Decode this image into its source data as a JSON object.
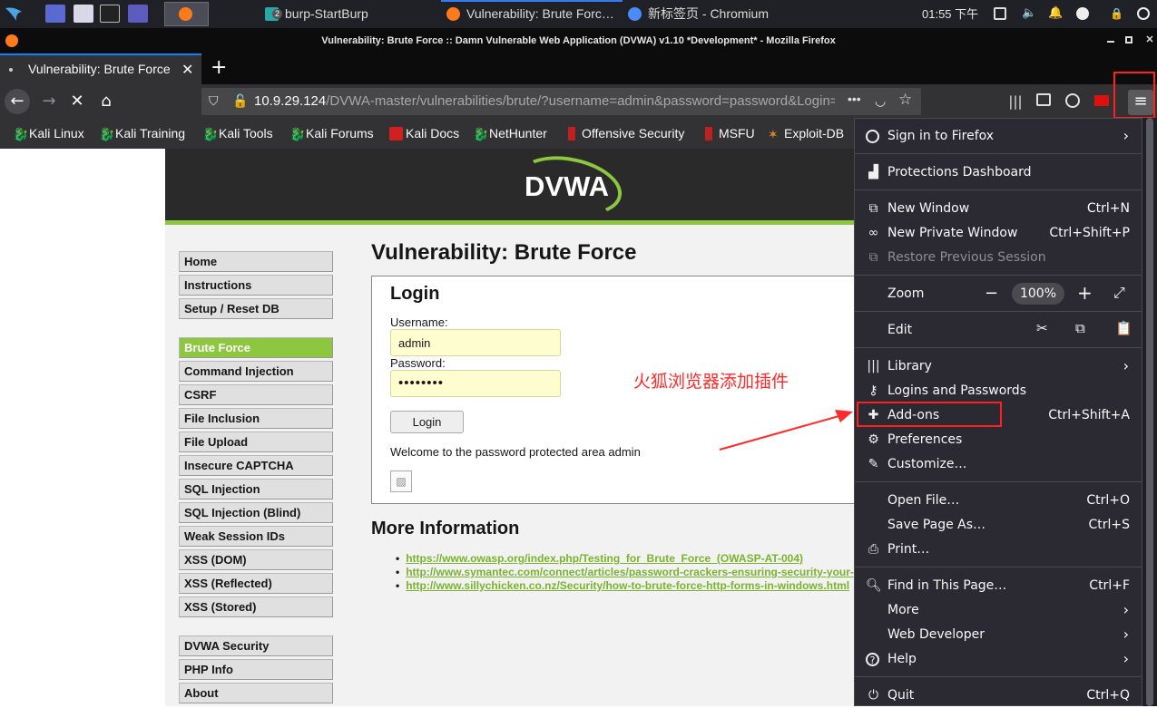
{
  "taskbar": {
    "tasks": [
      "burp-StartBurp",
      "Vulnerability: Brute Forc…",
      "新标签页 - Chromium"
    ],
    "badge": "2",
    "clock": "01:55 下午"
  },
  "window": {
    "title": "Vulnerability: Brute Force :: Damn Vulnerable Web Application (DVWA) v1.10 *Development* - Mozilla Firefox",
    "tab_label": "Vulnerability: Brute Force",
    "tab_close": "✕",
    "new_tab": "+",
    "url_host": "10.9.29.124",
    "url_path": "/DVWA-master/vulnerabilities/brute/?username=admin&password=password&Login=Login"
  },
  "bookmarks": [
    "Kali Linux",
    "Kali Training",
    "Kali Tools",
    "Kali Forums",
    "Kali Docs",
    "NetHunter",
    "Offensive Security",
    "MSFU",
    "Exploit-DB"
  ],
  "dvwa": {
    "logo": "DVWA",
    "menu": [
      "Home",
      "Instructions",
      "Setup / Reset DB",
      "Brute Force",
      "Command Injection",
      "CSRF",
      "File Inclusion",
      "File Upload",
      "Insecure CAPTCHA",
      "SQL Injection",
      "SQL Injection (Blind)",
      "Weak Session IDs",
      "XSS (DOM)",
      "XSS (Reflected)",
      "XSS (Stored)",
      "DVWA Security",
      "PHP Info",
      "About"
    ],
    "selected_menu": "Brute Force",
    "title": "Vulnerability: Brute Force",
    "login_heading": "Login",
    "username_label": "Username:",
    "username_value": "admin",
    "password_label": "Password:",
    "password_mask": "••••••••",
    "login_button": "Login",
    "welcome": "Welcome to the password protected area admin",
    "more_info_heading": "More Information",
    "links": [
      "https://www.owasp.org/index.php/Testing_for_Brute_Force_(OWASP-AT-004)",
      "http://www.symantec.com/connect/articles/password-crackers-ensuring-security-your-password",
      "http://www.sillychicken.co.nz/Security/how-to-brute-force-http-forms-in-windows.html"
    ]
  },
  "annotation": {
    "text": "火狐浏览器添加插件",
    "color": "#ff2a2a"
  },
  "app_menu": {
    "sign_in": "Sign in to Firefox",
    "protections": "Protections Dashboard",
    "new_window": "New Window",
    "new_window_key": "Ctrl+N",
    "new_private": "New Private Window",
    "new_private_key": "Ctrl+Shift+P",
    "restore": "Restore Previous Session",
    "zoom": "Zoom",
    "zoom_minus": "−",
    "zoom_value": "100%",
    "zoom_plus": "+",
    "edit": "Edit",
    "library": "Library",
    "logins": "Logins and Passwords",
    "addons": "Add-ons",
    "addons_key": "Ctrl+Shift+A",
    "preferences": "Preferences",
    "customize": "Customize…",
    "open_file": "Open File…",
    "open_file_key": "Ctrl+O",
    "save_page": "Save Page As…",
    "save_page_key": "Ctrl+S",
    "print": "Print…",
    "find": "Find in This Page…",
    "find_key": "Ctrl+F",
    "more": "More",
    "web_dev": "Web Developer",
    "help": "Help",
    "quit": "Quit",
    "quit_key": "Ctrl+Q"
  },
  "colors": {
    "dvwa_green": "#8dc63f",
    "highlight_red": "#ff2020",
    "menu_bg": "#2b2a33"
  }
}
